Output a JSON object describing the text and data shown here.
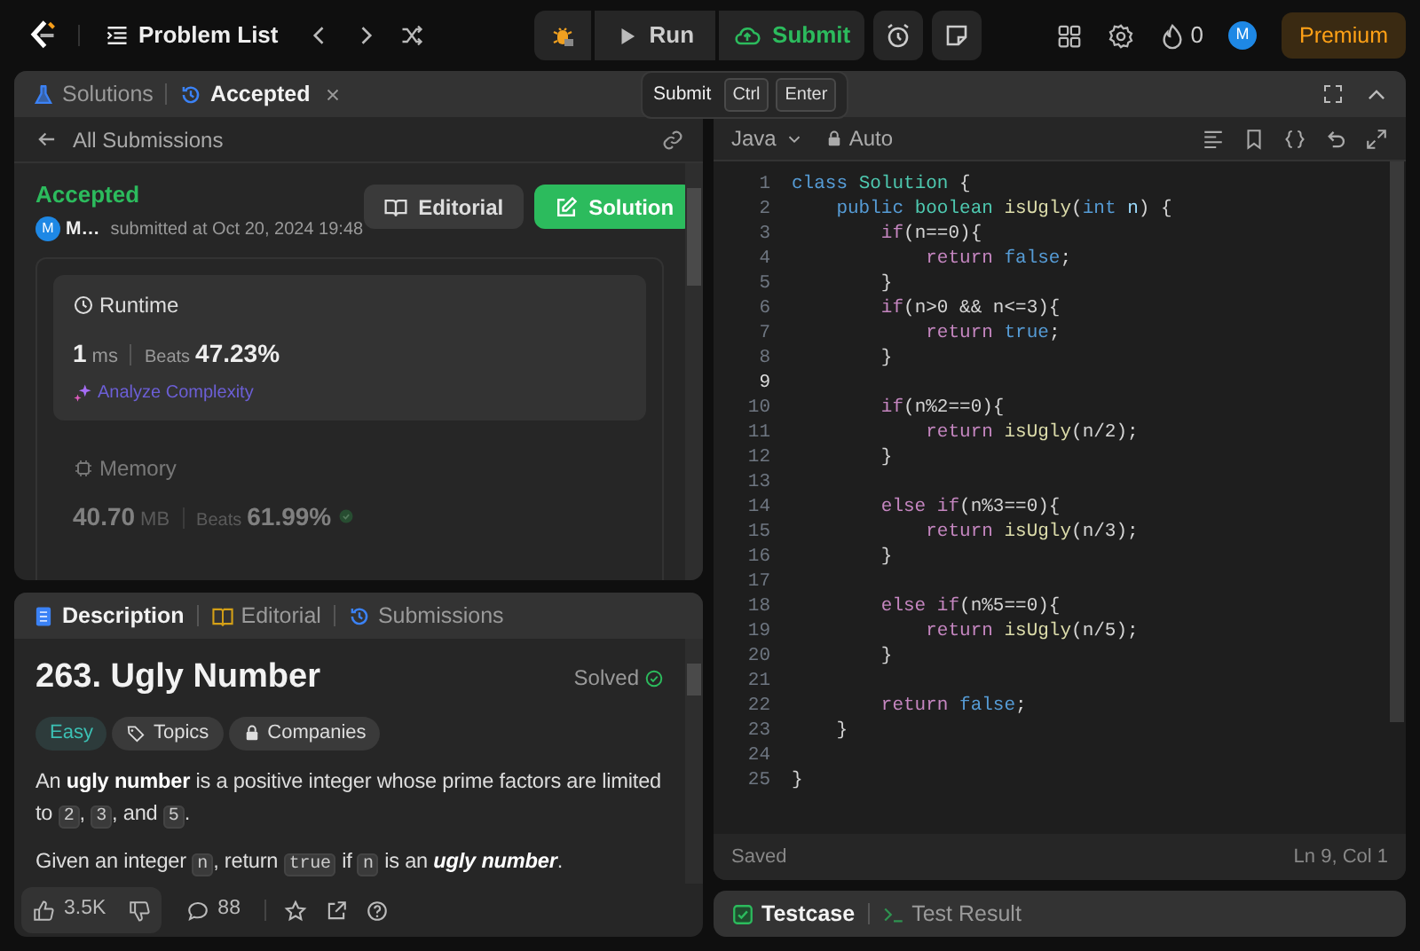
{
  "top_bar": {
    "problem_list": "Problem List",
    "run": "Run",
    "submit": "Submit",
    "streak": "0",
    "avatar": "M",
    "premium": "Premium"
  },
  "tooltip": {
    "label": "Submit",
    "keys": [
      "Ctrl",
      "Enter"
    ]
  },
  "left_panel": {
    "tabs": [
      {
        "label": "Solutions",
        "selected": false,
        "closable": false
      },
      {
        "label": "Accepted",
        "selected": true,
        "closable": true
      }
    ],
    "back_link": "All Submissions",
    "submission": {
      "status": "Accepted",
      "avatar": "M",
      "user": "M…",
      "submitted": "submitted at Oct 20, 2024 19:48",
      "buttons": [
        {
          "label": "Editorial",
          "kind": "secondary"
        },
        {
          "label": "Solution",
          "kind": "primary"
        }
      ]
    },
    "metrics": [
      {
        "title": "Runtime",
        "value": "1",
        "unit": "ms",
        "beats_label": "Beats",
        "beats": "47.23%",
        "selected": true,
        "link": "Analyze Complexity"
      },
      {
        "title": "Memory",
        "value": "40.70",
        "unit": "MB",
        "beats_label": "Beats",
        "beats": "61.99%",
        "selected": false
      }
    ]
  },
  "description_panel": {
    "tabs": [
      {
        "label": "Description",
        "selected": true
      },
      {
        "label": "Editorial",
        "selected": false
      },
      {
        "label": "Submissions",
        "selected": false
      }
    ],
    "title": "263. Ugly Number",
    "status": "Solved",
    "tags": [
      {
        "label": "Easy",
        "kind": "difficulty"
      },
      {
        "label": "Topics",
        "kind": "topics"
      },
      {
        "label": "Companies",
        "kind": "companies"
      }
    ],
    "paragraphs": [
      [
        {
          "kind": "text",
          "text": "An "
        },
        {
          "kind": "bold",
          "text": "ugly number"
        },
        {
          "kind": "text",
          "text": " is a positive integer whose prime factors are limited to "
        },
        {
          "kind": "code",
          "text": "2"
        },
        {
          "kind": "text",
          "text": ", "
        },
        {
          "kind": "code",
          "text": "3"
        },
        {
          "kind": "text",
          "text": ", and "
        },
        {
          "kind": "code",
          "text": "5"
        },
        {
          "kind": "text",
          "text": "."
        }
      ],
      [
        {
          "kind": "text",
          "text": "Given an integer "
        },
        {
          "kind": "code",
          "text": "n"
        },
        {
          "kind": "text",
          "text": ", return "
        },
        {
          "kind": "code",
          "text": "true"
        },
        {
          "kind": "text",
          "text": " if "
        },
        {
          "kind": "code",
          "text": "n"
        },
        {
          "kind": "text",
          "text": " is an "
        },
        {
          "kind": "bolditalic",
          "text": "ugly number"
        },
        {
          "kind": "text",
          "text": "."
        }
      ]
    ],
    "footer": {
      "likes": "3.5K",
      "comments": "88"
    }
  },
  "editor": {
    "language": "Java",
    "mode": "Auto",
    "lines": [
      {
        "number": "1",
        "current": false,
        "tokens": [
          {
            "kind": "keyword",
            "text": "class"
          },
          {
            "kind": "type",
            "text": " Solution"
          },
          {
            "kind": "plain",
            "text": " {"
          }
        ]
      },
      {
        "number": "2",
        "current": false,
        "tokens": [
          {
            "kind": "keyword",
            "text": "    public"
          },
          {
            "kind": "type",
            "text": " boolean"
          },
          {
            "kind": "function",
            "text": " isUgly"
          },
          {
            "kind": "plain",
            "text": "("
          },
          {
            "kind": "keyword",
            "text": "int"
          },
          {
            "kind": "variable",
            "text": " n"
          },
          {
            "kind": "plain",
            "text": ") {"
          }
        ]
      },
      {
        "number": "3",
        "current": false,
        "tokens": [
          {
            "kind": "control",
            "text": "        if"
          },
          {
            "kind": "plain",
            "text": "(n==0){"
          }
        ]
      },
      {
        "number": "4",
        "current": false,
        "tokens": [
          {
            "kind": "control",
            "text": "            return"
          },
          {
            "kind": "keyword",
            "text": " false"
          },
          {
            "kind": "plain",
            "text": ";"
          }
        ]
      },
      {
        "number": "5",
        "current": false,
        "tokens": [
          {
            "kind": "plain",
            "text": "        }"
          }
        ]
      },
      {
        "number": "6",
        "current": false,
        "tokens": [
          {
            "kind": "control",
            "text": "        if"
          },
          {
            "kind": "plain",
            "text": "(n>0 && n<=3){"
          }
        ]
      },
      {
        "number": "7",
        "current": false,
        "tokens": [
          {
            "kind": "control",
            "text": "            return"
          },
          {
            "kind": "keyword",
            "text": " true"
          },
          {
            "kind": "plain",
            "text": ";"
          }
        ]
      },
      {
        "number": "8",
        "current": false,
        "tokens": [
          {
            "kind": "plain",
            "text": "        }"
          }
        ]
      },
      {
        "number": "9",
        "current": true
      },
      {
        "number": "10",
        "current": false,
        "tokens": [
          {
            "kind": "control",
            "text": "        if"
          },
          {
            "kind": "plain",
            "text": "(n%2==0){"
          }
        ]
      },
      {
        "number": "11",
        "current": false,
        "tokens": [
          {
            "kind": "control",
            "text": "            return"
          },
          {
            "kind": "function",
            "text": " isUgly"
          },
          {
            "kind": "plain",
            "text": "(n/2);"
          }
        ]
      },
      {
        "number": "12",
        "current": false,
        "tokens": [
          {
            "kind": "plain",
            "text": "        }"
          }
        ]
      },
      {
        "number": "13",
        "current": false
      },
      {
        "number": "14",
        "current": false,
        "tokens": [
          {
            "kind": "control",
            "text": "        else if"
          },
          {
            "kind": "plain",
            "text": "(n%3==0){"
          }
        ]
      },
      {
        "number": "15",
        "current": false,
        "tokens": [
          {
            "kind": "control",
            "text": "            return"
          },
          {
            "kind": "function",
            "text": " isUgly"
          },
          {
            "kind": "plain",
            "text": "(n/3);"
          }
        ]
      },
      {
        "number": "16",
        "current": false,
        "tokens": [
          {
            "kind": "plain",
            "text": "        }"
          }
        ]
      },
      {
        "number": "17",
        "current": false
      },
      {
        "number": "18",
        "current": false,
        "tokens": [
          {
            "kind": "control",
            "text": "        else if"
          },
          {
            "kind": "plain",
            "text": "(n%5==0){"
          }
        ]
      },
      {
        "number": "19",
        "current": false,
        "tokens": [
          {
            "kind": "control",
            "text": "            return"
          },
          {
            "kind": "function",
            "text": " isUgly"
          },
          {
            "kind": "plain",
            "text": "(n/5);"
          }
        ]
      },
      {
        "number": "20",
        "current": false,
        "tokens": [
          {
            "kind": "plain",
            "text": "        }"
          }
        ]
      },
      {
        "number": "21",
        "current": false
      },
      {
        "number": "22",
        "current": false,
        "tokens": [
          {
            "kind": "control",
            "text": "        return"
          },
          {
            "kind": "keyword",
            "text": " false"
          },
          {
            "kind": "plain",
            "text": ";"
          }
        ]
      },
      {
        "number": "23",
        "current": false,
        "tokens": [
          {
            "kind": "plain",
            "text": "    }"
          }
        ]
      },
      {
        "number": "24",
        "current": false
      },
      {
        "number": "25",
        "current": false,
        "tokens": [
          {
            "kind": "plain",
            "text": "}"
          }
        ]
      }
    ],
    "status": "Saved",
    "cursor": "Ln 9, Col 1"
  },
  "bottom_panel": {
    "tabs": [
      {
        "label": "Testcase",
        "selected": true
      },
      {
        "label": "Test Result",
        "selected": false
      }
    ]
  }
}
